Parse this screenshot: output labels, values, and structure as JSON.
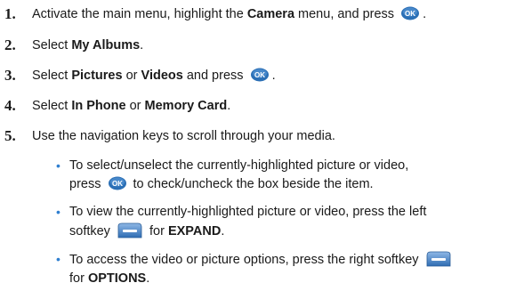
{
  "steps": [
    {
      "number": "1.",
      "pre": "Activate the main menu, highlight the ",
      "bold1": "Camera",
      "mid": " menu, and press ",
      "ok_icon": "ok-key-icon",
      "post": "."
    },
    {
      "number": "2.",
      "pre": "Select ",
      "bold1": "My Albums",
      "post": "."
    },
    {
      "number": "3.",
      "pre": "Select ",
      "bold1": "Pictures",
      "mid": " or ",
      "bold2": "Videos",
      "mid2": " and press ",
      "ok_icon": "ok-key-icon",
      "post": "."
    },
    {
      "number": "4.",
      "pre": "Select ",
      "bold1": "In Phone",
      "mid": " or ",
      "bold2": "Memory Card",
      "post": "."
    },
    {
      "number": "5.",
      "text": "Use the navigation keys to scroll through your media."
    }
  ],
  "sub_items": [
    {
      "line1": "To select/unselect the currently-highlighted picture or video,",
      "line2_pre": "press ",
      "ok_icon": "ok-key-icon",
      "line2_post": " to check/uncheck the box beside the item."
    },
    {
      "line1": "To view the currently-highlighted picture or video, press the left",
      "line2_pre": "softkey ",
      "softkey_icon": "left-softkey-icon",
      "line2_mid": " for ",
      "line2_bold": "EXPAND",
      "line2_post": "."
    },
    {
      "line1": "To access the video or picture options, press the right softkey ",
      "softkey_icon": "right-softkey-icon",
      "line2_pre": "for ",
      "line2_bold": "OPTIONS",
      "line2_post": "."
    }
  ],
  "bullet_color": "#2f7fd0",
  "ok_key_color": "#2b6fb5"
}
